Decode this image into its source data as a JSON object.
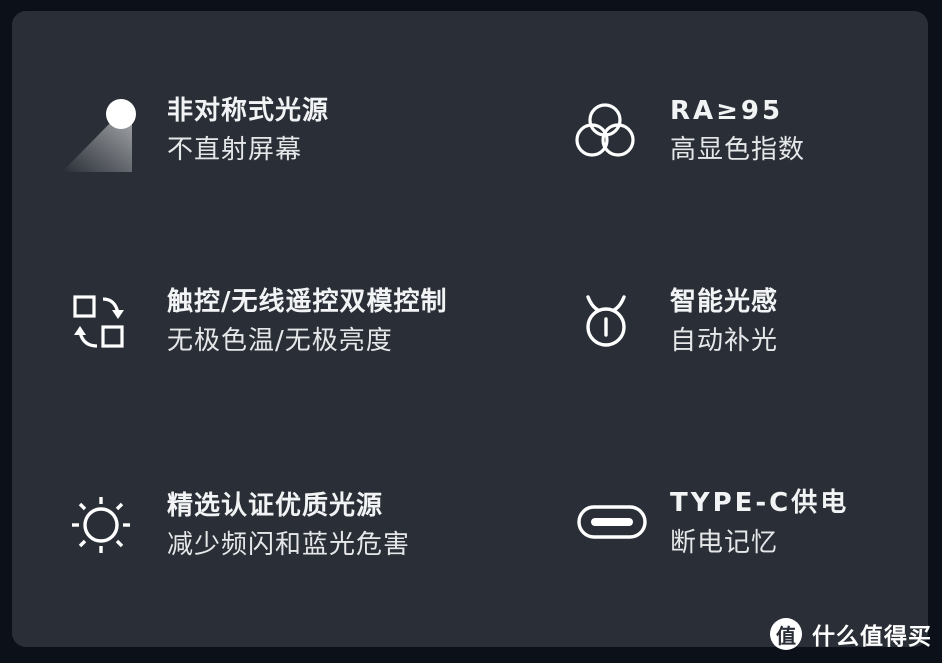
{
  "colors": {
    "background": "#0c1119",
    "panel": "#2a2f37",
    "text": "#f2f3f4",
    "icon": "#ffffff"
  },
  "features": [
    {
      "icon": "spotlight-icon",
      "title": "非对称式光源",
      "subtitle": "不直射屏幕"
    },
    {
      "icon": "color-circles-icon",
      "title": "RA≥95",
      "subtitle": "高显色指数"
    },
    {
      "icon": "switch-control-icon",
      "title": "触控/无线遥控双模控制",
      "subtitle": "无极色温/无极亮度"
    },
    {
      "icon": "light-sensor-icon",
      "title": "智能光感",
      "subtitle": "自动补光"
    },
    {
      "icon": "sun-icon",
      "title": "精选认证优质光源",
      "subtitle": "减少频闪和蓝光危害"
    },
    {
      "icon": "usb-c-port-icon",
      "title": "TYPE-C供电",
      "subtitle": "断电记忆"
    }
  ],
  "watermark": {
    "badge": "值",
    "text": "什么值得买"
  }
}
